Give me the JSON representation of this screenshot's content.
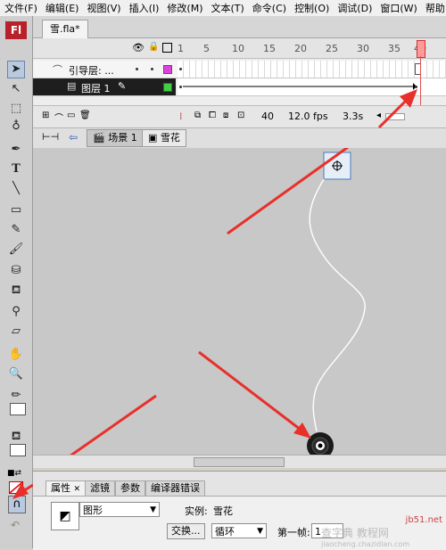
{
  "menu": [
    "文件(F)",
    "编辑(E)",
    "视图(V)",
    "插入(I)",
    "修改(M)",
    "文本(T)",
    "命令(C)",
    "控制(O)",
    "调试(D)",
    "窗口(W)",
    "帮助"
  ],
  "document": {
    "tab_label": "雪.fla*"
  },
  "app": {
    "logo": "Fl"
  },
  "timeline": {
    "ruler": [
      "1",
      "5",
      "10",
      "15",
      "20",
      "25",
      "30",
      "35",
      "40"
    ],
    "layers": [
      {
        "name": "引导层: ...",
        "icon": "guide-layer-icon",
        "color": "#e040e0"
      },
      {
        "name": "图层 1",
        "icon": "layer-icon",
        "color": "#40d040",
        "selected": true
      }
    ],
    "footer": {
      "frame": "40",
      "fps": "12.0 fps",
      "time": "3.3s"
    }
  },
  "editbar": {
    "scene": "场景 1",
    "symbol": "雪花"
  },
  "properties": {
    "tabs": [
      "属性",
      "滤镜",
      "参数",
      "编译器错误"
    ],
    "type_value": "图形",
    "instance_label": "实例:",
    "instance_name": "雪花",
    "swap_button": "交换...",
    "loop_value": "循环",
    "first_frame_label": "第一帧:",
    "first_frame_value": "1"
  },
  "watermark": {
    "line1": "jb51.net",
    "line2": "查字典 教程网",
    "line3": "jiaocheng.chazidian.com"
  },
  "colors": {
    "accent_red": "#e8302a",
    "stage": "#c8c8c8",
    "playhead": "#ff6b6b"
  }
}
